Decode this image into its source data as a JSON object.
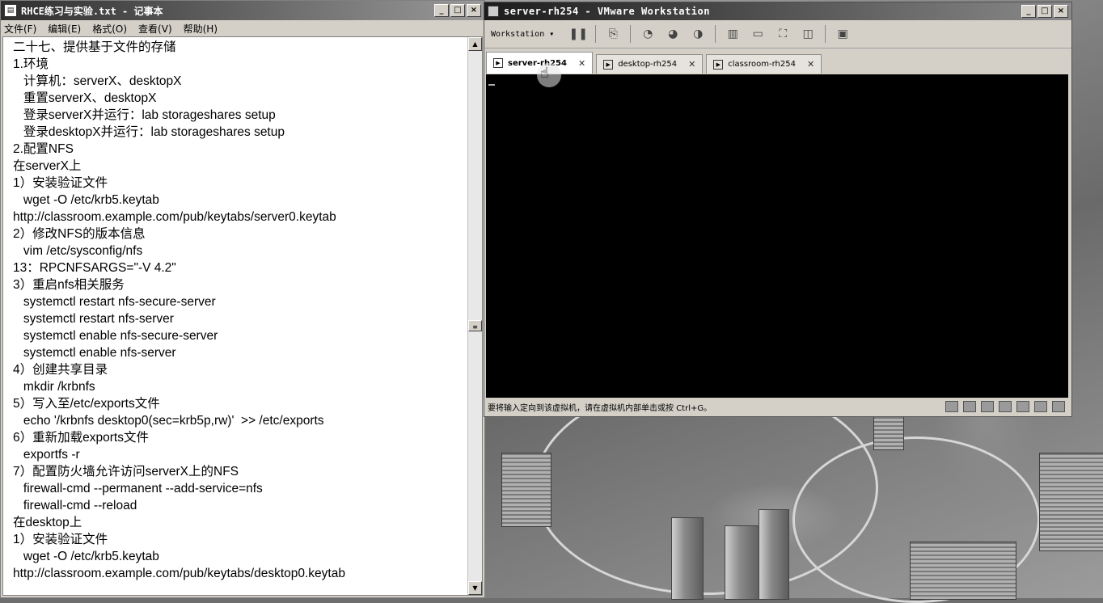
{
  "notepad": {
    "title": "RHCE练习与实验.txt - 记事本",
    "menu": [
      "文件(F)",
      "编辑(E)",
      "格式(O)",
      "查看(V)",
      "帮助(H)"
    ],
    "lines": [
      "二十七、提供基于文件的存储",
      "1.环境",
      "   计算机：serverX、desktopX",
      "   重置serverX、desktopX",
      "   登录serverX并运行：lab storageshares setup",
      "   登录desktopX并运行：lab storageshares setup",
      "2.配置NFS",
      "在serverX上",
      "1）安装验证文件",
      "   wget -O /etc/krb5.keytab",
      "http://classroom.example.com/pub/keytabs/server0.keytab",
      "2）修改NFS的版本信息",
      "   vim /etc/sysconfig/nfs",
      "13：RPCNFSARGS=\"-V 4.2\"",
      "3）重启nfs相关服务",
      "   systemctl restart nfs-secure-server",
      "   systemctl restart nfs-server",
      "   systemctl enable nfs-secure-server",
      "   systemctl enable nfs-server",
      "4）创建共享目录",
      "   mkdir /krbnfs",
      "5）写入至/etc/exports文件",
      "   echo '/krbnfs desktop0(sec=krb5p,rw)'  >> /etc/exports",
      "6）重新加载exports文件",
      "   exportfs -r",
      "7）配置防火墙允许访问serverX上的NFS",
      "   firewall-cmd --permanent --add-service=nfs",
      "   firewall-cmd --reload",
      "在desktop上",
      "1）安装验证文件",
      "   wget -O /etc/krb5.keytab",
      "http://classroom.example.com/pub/keytabs/desktop0.keytab"
    ]
  },
  "vmware": {
    "title": "server-rh254 - VMware Workstation",
    "toolbar_dropdown": "Workstation ▾",
    "tabs": [
      {
        "label": "server-rh254",
        "active": true
      },
      {
        "label": "desktop-rh254",
        "active": false
      },
      {
        "label": "classroom-rh254",
        "active": false
      }
    ],
    "status_message": "要将输入定向到该虚拟机，请在虚拟机内部单击或按 Ctrl+G。"
  }
}
